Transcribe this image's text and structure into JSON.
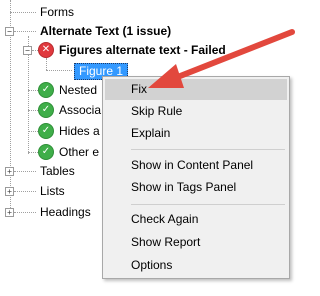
{
  "tree": {
    "forms": "Forms",
    "alternate_text": "Alternate Text (1 issue)",
    "figures_alt_failed": "Figures alternate text - Failed",
    "figure_1": "Figure 1",
    "nested": "Nested",
    "associated": "Associa",
    "hides": "Hides a",
    "other": "Other e",
    "tables": "Tables",
    "lists": "Lists",
    "headings": "Headings"
  },
  "context_menu": {
    "fix": "Fix",
    "skip_rule": "Skip Rule",
    "explain": "Explain",
    "show_content_panel": "Show in Content Panel",
    "show_tags_panel": "Show in Tags Panel",
    "check_again": "Check Again",
    "show_report": "Show Report",
    "options": "Options"
  },
  "colors": {
    "selection": "#3399ff",
    "menu_highlight": "#d2d2d2",
    "fail": "#e0393e",
    "pass": "#3fae49",
    "annotation_arrow": "#e2483d"
  },
  "icons": {
    "expand": "plus-box-icon",
    "collapse": "minus-box-icon",
    "failed": "red-x-circle-icon",
    "passed": "green-check-circle-icon"
  }
}
